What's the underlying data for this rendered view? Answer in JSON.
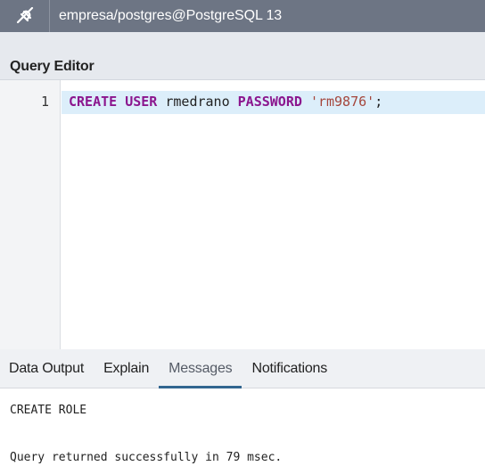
{
  "connection": {
    "icon": "connection-plug-icon",
    "label": "empresa/postgres@PostgreSQL 13"
  },
  "panel": {
    "title": "Query Editor"
  },
  "editor": {
    "line_number": "1",
    "tokens": {
      "kw_create": "CREATE",
      "sp1": " ",
      "kw_user": "USER",
      "ident": " rmedrano ",
      "kw_password": "PASSWORD",
      "sp2": " ",
      "string": "'rm9876'",
      "semicolon": ";"
    }
  },
  "tabs": [
    {
      "label": "Data Output",
      "active": false
    },
    {
      "label": "Explain",
      "active": false
    },
    {
      "label": "Messages",
      "active": true
    },
    {
      "label": "Notifications",
      "active": false
    }
  ],
  "messages": {
    "line1": "CREATE ROLE",
    "line2": "Query returned successfully in 79 msec."
  },
  "colors": {
    "topbar": "#6d7584",
    "keyword": "#8b168e",
    "string": "#a5463c",
    "active_tab_underline": "#326690",
    "active_line": "#dceefa"
  }
}
